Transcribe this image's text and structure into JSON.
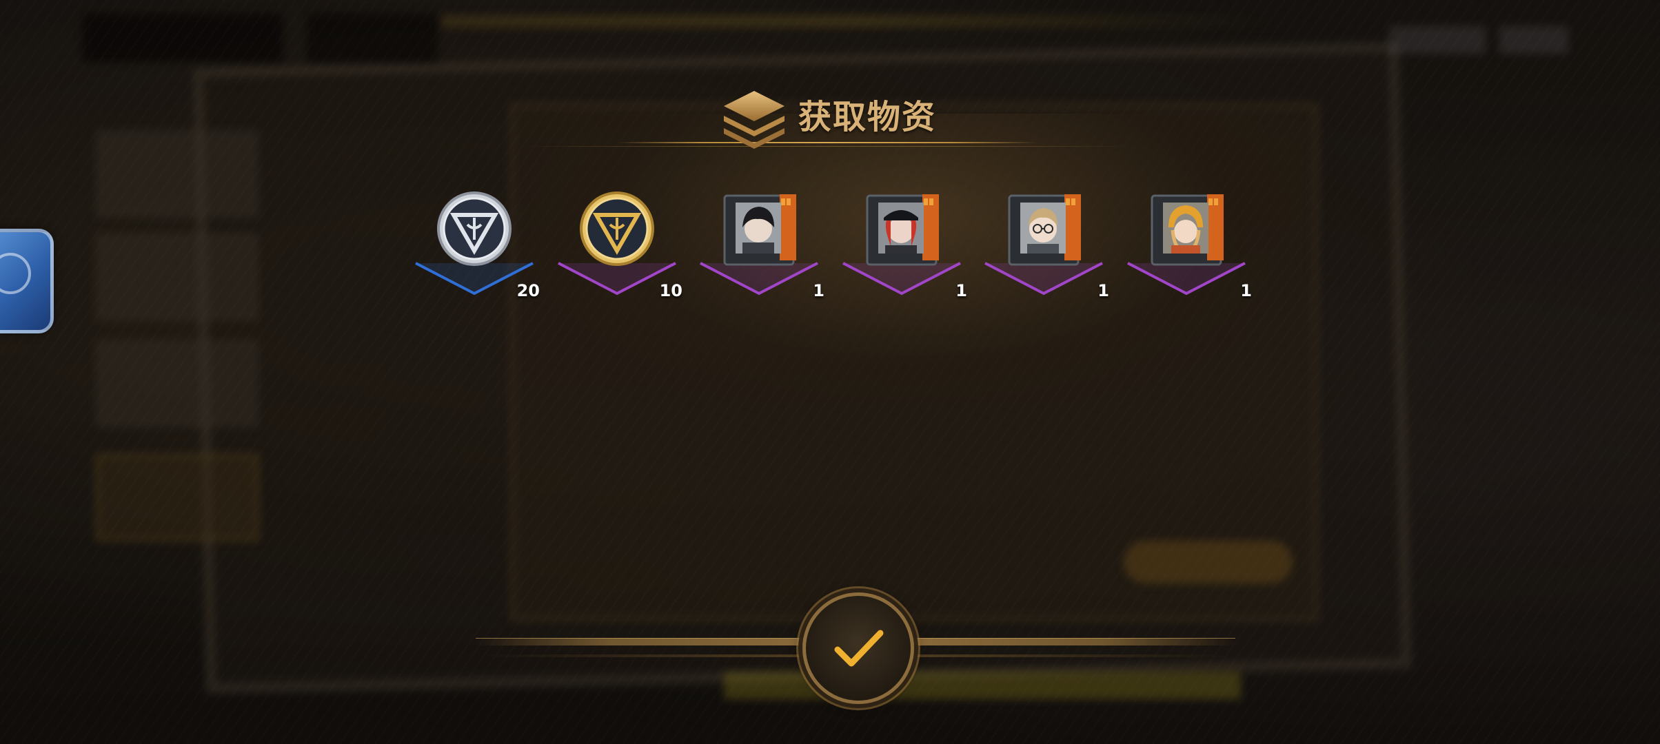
{
  "reward_popup": {
    "title": "获取物资",
    "items": [
      {
        "name": "silver-medal",
        "quantity": "20",
        "rarity": "blue"
      },
      {
        "name": "gold-medal",
        "quantity": "10",
        "rarity": "purple"
      },
      {
        "name": "black-hair-character-card",
        "quantity": "1",
        "rarity": "purple"
      },
      {
        "name": "red-hair-cap-character-card",
        "quantity": "1",
        "rarity": "purple"
      },
      {
        "name": "glasses-character-card",
        "quantity": "1",
        "rarity": "purple"
      },
      {
        "name": "helmet-character-card",
        "quantity": "1",
        "rarity": "purple"
      }
    ],
    "confirm_icon": "check-icon"
  },
  "colors": {
    "title_gold": "#d9b278",
    "rarity_blue": "#2f6fd6",
    "rarity_purple": "#a246c9",
    "confirm_check": "#f0b030"
  }
}
